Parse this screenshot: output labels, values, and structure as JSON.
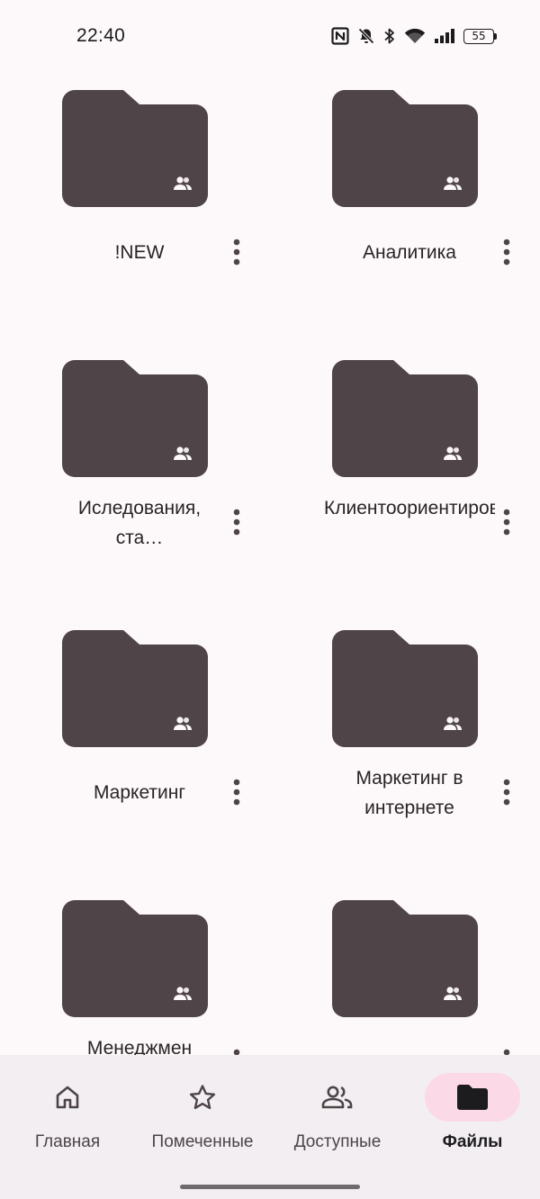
{
  "status_bar": {
    "time": "22:40",
    "battery": "55",
    "icons": [
      "nfc-icon",
      "mute-icon",
      "bluetooth-icon",
      "wifi-icon",
      "signal-icon",
      "battery-icon"
    ]
  },
  "folders": [
    {
      "name": "!NEW",
      "shared": true
    },
    {
      "name": "Аналитика",
      "shared": true
    },
    {
      "name": "Иследования, ста…",
      "shared": true
    },
    {
      "name": "Клиентоориентировано…",
      "shared": true
    },
    {
      "name": "Маркетинг",
      "shared": true
    },
    {
      "name": "Маркетинг в интернете",
      "shared": true
    },
    {
      "name": "Менеджмен",
      "shared": true
    },
    {
      "name": "",
      "shared": true
    }
  ],
  "nav": {
    "items": [
      {
        "label": "Главная",
        "icon": "home-icon",
        "active": false
      },
      {
        "label": "Помеченные",
        "icon": "star-icon",
        "active": false
      },
      {
        "label": "Доступные",
        "icon": "people-icon",
        "active": false
      },
      {
        "label": "Файлы",
        "icon": "folder-icon",
        "active": true
      }
    ]
  },
  "colors": {
    "background": "#fdf8fa",
    "folder": "#4f4448",
    "nav_background": "#f3eef1",
    "active_pill": "#fbd9e6"
  }
}
